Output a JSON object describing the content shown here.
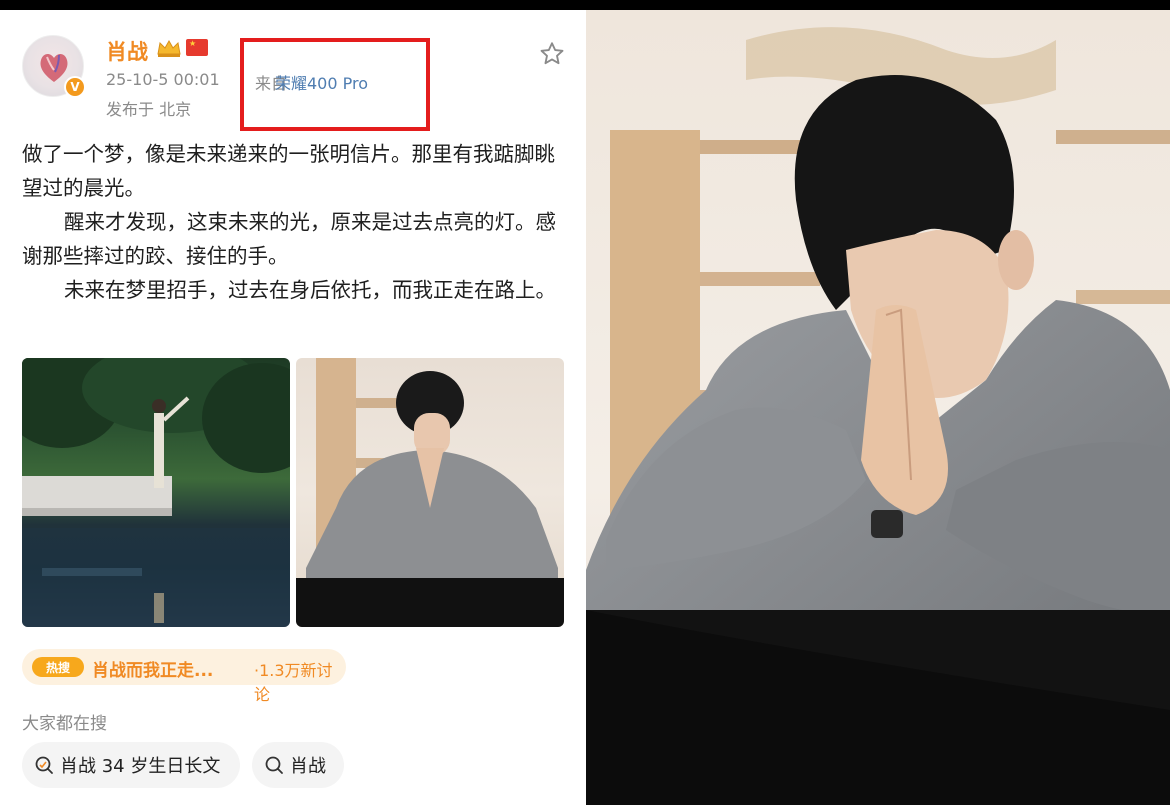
{
  "post": {
    "username": "肖战",
    "verified_badge": "V",
    "timestamp": "25-10-5 00:01",
    "source_prefix": "来自",
    "source_device": "荣耀400 Pro",
    "location": "发布于 北京",
    "paragraphs": [
      "做了一个梦，像是未来递来的一张明信片。那里有我踮脚眺望过的晨光。",
      "醒来才发现，这束未来的光，原来是过去点亮的灯。感谢那些摔过的跤、接住的手。",
      "未来在梦里招手，过去在身后依托，而我正走在路上。"
    ],
    "icons": [
      "crown-icon",
      "china-flag-icon",
      "star-icon",
      "search-icon",
      "birthday-search-icon"
    ]
  },
  "hot_search": {
    "badge": "热搜",
    "topic": "肖战而我正走...",
    "count": "·1.3万新讨论"
  },
  "everyone_searching": {
    "heading": "大家都在搜",
    "chips": [
      "肖战 34 岁生日长文",
      "肖战"
    ]
  },
  "colors": {
    "username": "#f08a24",
    "link": "#4f7db1",
    "highlight_box": "#e41d1d",
    "hot_bg": "#fdf1df",
    "hot_badge": "#f7a81c",
    "verified": "#f39a1e"
  }
}
